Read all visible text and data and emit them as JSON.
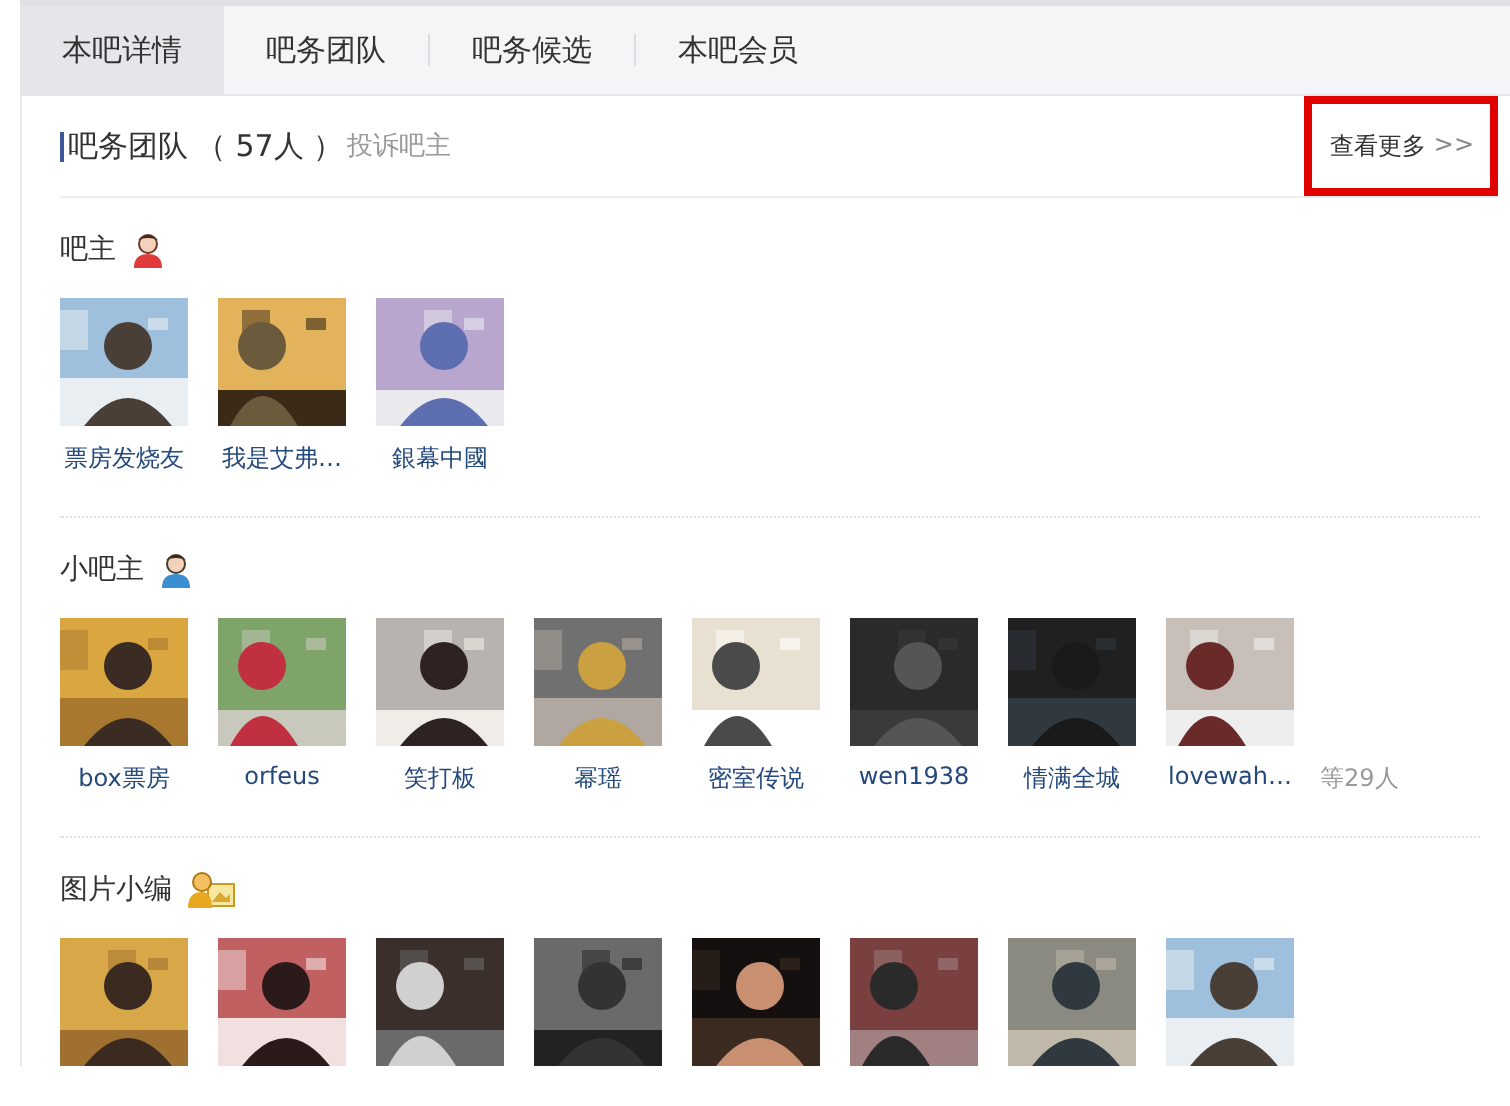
{
  "tabs": [
    {
      "label": "本吧详情",
      "selected": true
    },
    {
      "label": "吧务团队",
      "selected": false
    },
    {
      "label": "吧务候选",
      "selected": false
    },
    {
      "label": "本吧会员",
      "selected": false
    }
  ],
  "team": {
    "title": "吧务团队",
    "count": "（ 57人 ）",
    "complain_link": "投诉吧主",
    "more_link": "查看更多",
    "more_arrow": ">>",
    "highlighted": true
  },
  "sections": [
    {
      "title": "吧主",
      "kind": "owner",
      "members": [
        {
          "name": "票房发烧友",
          "kind": "picture"
        },
        {
          "name": "我是艾弗…",
          "kind": "picture"
        },
        {
          "name": "銀幕中國",
          "kind": "picture"
        }
      ]
    },
    {
      "title": "小吧主",
      "kind": "assistant",
      "members": [
        {
          "name": "box票房",
          "kind": "picture"
        },
        {
          "name": "orfeus",
          "kind": "picture"
        },
        {
          "name": "笑打板",
          "kind": "picture"
        },
        {
          "name": "幂瑶",
          "kind": "picture"
        },
        {
          "name": "密室传说",
          "kind": "picture"
        },
        {
          "name": "wen1938",
          "kind": "picture"
        },
        {
          "name": "情满全城",
          "kind": "picture"
        },
        {
          "name": "lovewah…",
          "kind": "picture"
        }
      ],
      "more": "等29人"
    },
    {
      "title": "图片小编",
      "kind": "photo-editor"
    }
  ]
}
